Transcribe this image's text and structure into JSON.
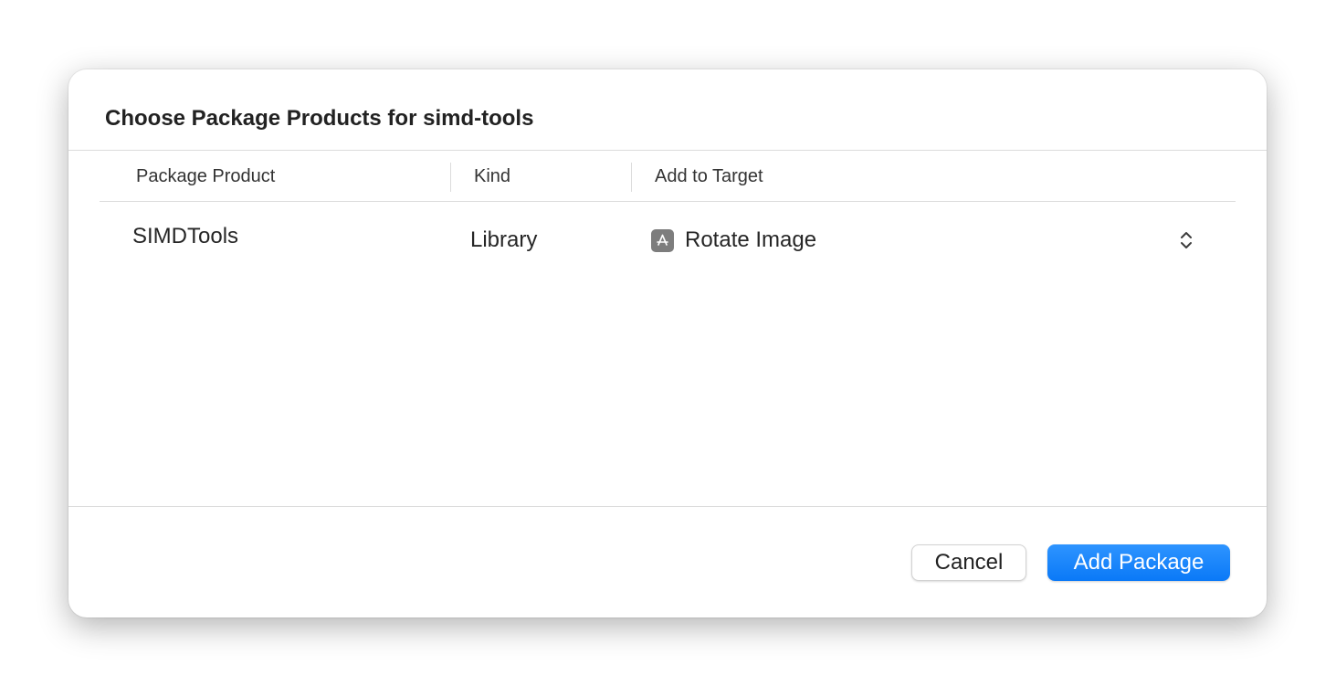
{
  "dialog": {
    "title": "Choose Package Products for simd-tools"
  },
  "table": {
    "columns": [
      {
        "label": "Package Product"
      },
      {
        "label": "Kind"
      },
      {
        "label": "Add to Target"
      }
    ],
    "rows": [
      {
        "product": "SIMDTools",
        "kind": "Library",
        "target": {
          "icon": "app-store-icon",
          "label": "Rotate Image"
        }
      }
    ]
  },
  "footer": {
    "cancel_label": "Cancel",
    "add_label": "Add Package"
  },
  "colors": {
    "accent": "#0a79f7",
    "icon_gray": "#7d7d7d"
  }
}
